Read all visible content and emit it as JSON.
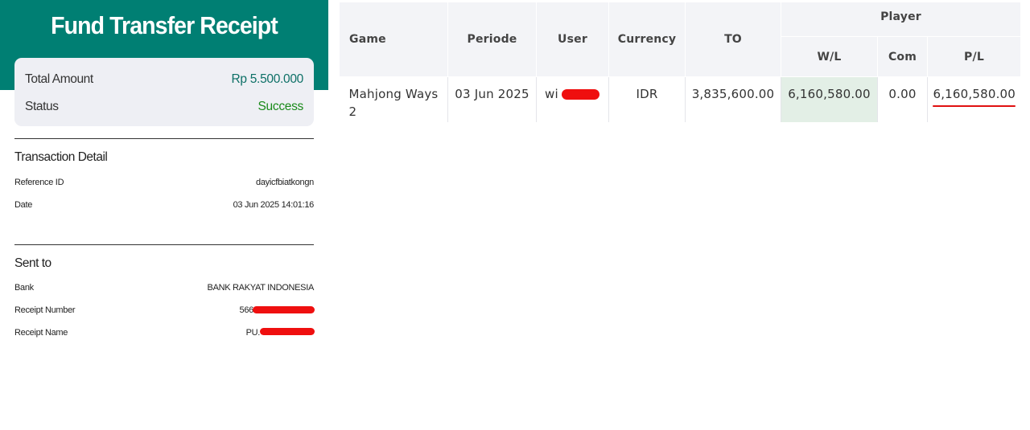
{
  "receipt": {
    "title": "Fund Transfer Receipt",
    "summary": {
      "total_label": "Total Amount",
      "total_value": "Rp 5.500.000",
      "status_label": "Status",
      "status_value": "Success"
    },
    "transaction_detail": {
      "title": "Transaction Detail",
      "rows": [
        {
          "label": "Reference ID",
          "value": "dayicfbiatkongn"
        },
        {
          "label": "Date",
          "value": "03 Jun 2025 14:01:16"
        }
      ]
    },
    "sent_to": {
      "title": "Sent to",
      "bank_label": "Bank",
      "bank_value": "BANK RAKYAT INDONESIA",
      "receipt_number_label": "Receipt Number",
      "receipt_number_visible": "566",
      "receipt_name_label": "Receipt Name",
      "receipt_name_visible": "PU."
    },
    "colors": {
      "header": "#007f73",
      "amount": "#0d7066",
      "success": "#1a8a1a",
      "redaction": "#ef0f0f"
    }
  },
  "bet_table": {
    "headers": {
      "game": "Game",
      "periode": "Periode",
      "user": "User",
      "currency": "Currency",
      "to": "TO",
      "player": "Player",
      "wl": "W/L",
      "com": "Com",
      "pl": "P/L"
    },
    "row": {
      "game": "Mahjong Ways 2",
      "periode": "03 Jun 2025",
      "user_visible": "wi",
      "currency": "IDR",
      "to": "3,835,600.00",
      "wl": "6,160,580.00",
      "com": "0.00",
      "pl": "6,160,580.00"
    },
    "colors": {
      "header_bg": "#f3f4f7",
      "wl_cell": "#e3efe6",
      "pl_underline": "#e01010"
    }
  }
}
